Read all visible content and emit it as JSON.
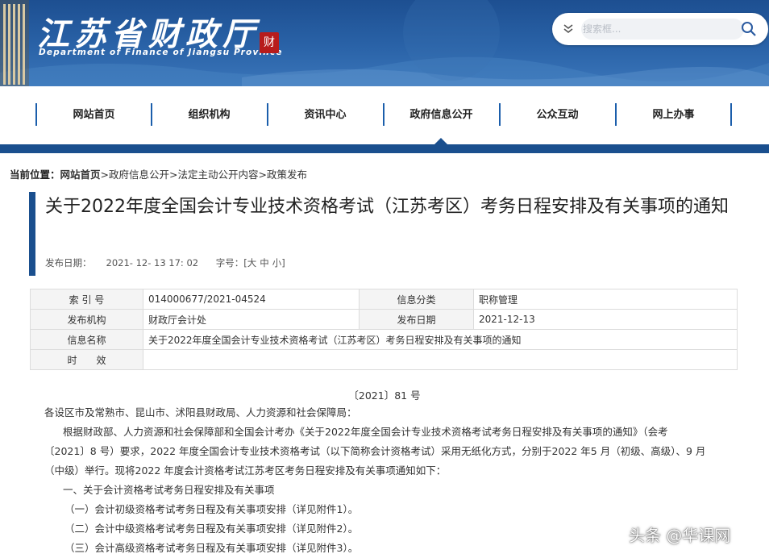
{
  "site": {
    "title_cn": "江苏省财政厅",
    "title_en": "Department of Finance of Jiangsu Province",
    "seal_text": "财"
  },
  "search": {
    "placeholder": "搜索框..."
  },
  "nav": {
    "items": [
      {
        "label": "网站首页"
      },
      {
        "label": "组织机构"
      },
      {
        "label": "资讯中心"
      },
      {
        "label": "政府信息公开"
      },
      {
        "label": "公众互动"
      },
      {
        "label": "网上办事"
      }
    ]
  },
  "breadcrumb": {
    "prefix": "当前位置：",
    "items": [
      "网站首页",
      "政府信息公开",
      "法定主动公开内容",
      "政策发布"
    ],
    "sep": ">"
  },
  "article": {
    "title": "关于2022年度全国会计专业技术资格考试（江苏考区）考务日程安排及有关事项的通知",
    "publish_label": "发布日期：",
    "publish_value": "2021- 12- 13   17: 02",
    "font_label": "字号：[",
    "font_large": "大",
    "font_medium": "中",
    "font_small": "小",
    "font_end": "]"
  },
  "info": {
    "index_label": "索 引 号",
    "index_value": "014000677/2021-04524",
    "category_label": "信息分类",
    "category_value": "职称管理",
    "org_label": "发布机构",
    "org_value": "财政厅会计处",
    "date_label": "发布日期",
    "date_value": "2021-12-13",
    "name_label": "信息名称",
    "name_value": "关于2022年度全国会计专业技术资格考试（江苏考区）考务日程安排及有关事项的通知",
    "valid_label": "时　　效",
    "valid_value": ""
  },
  "body": {
    "doc_no": "〔2021〕81 号",
    "addressee": "各设区市及常熟市、昆山市、沭阳县财政局、人力资源和社会保障局：",
    "para1_line1": "根据财政部、人力资源和社会保障部和全国会计考办《关于2022年度全国会计专业技术资格考试考务日程安排及有关事项的通知》（会考",
    "para1_line2": "〔2021〕8 号）要求，2022 年度全国会计专业技术资格考试（以下简称会计资格考试）采用无纸化方式，分别于2022 年5 月（初级、高级）、9 月",
    "para1_line3": "（中级）举行。现将2022 年度会计资格考试江苏考区考务日程安排及有关事项通知如下：",
    "section1": "一、关于会计资格考试考务日程安排及有关事项",
    "item1": "（一）会计初级资格考试考务日程及有关事项安排（详见附件1）。",
    "item2": "（二）会计中级资格考试考务日程及有关事项安排（详见附件2）。",
    "item3": "（三）会计高级资格考试考务日程及有关事项安排（详见附件3）。"
  },
  "watermark": "头条 @华课网",
  "colors": {
    "brand_blue": "#1a4f8e",
    "seal_red": "#b71c1c"
  }
}
